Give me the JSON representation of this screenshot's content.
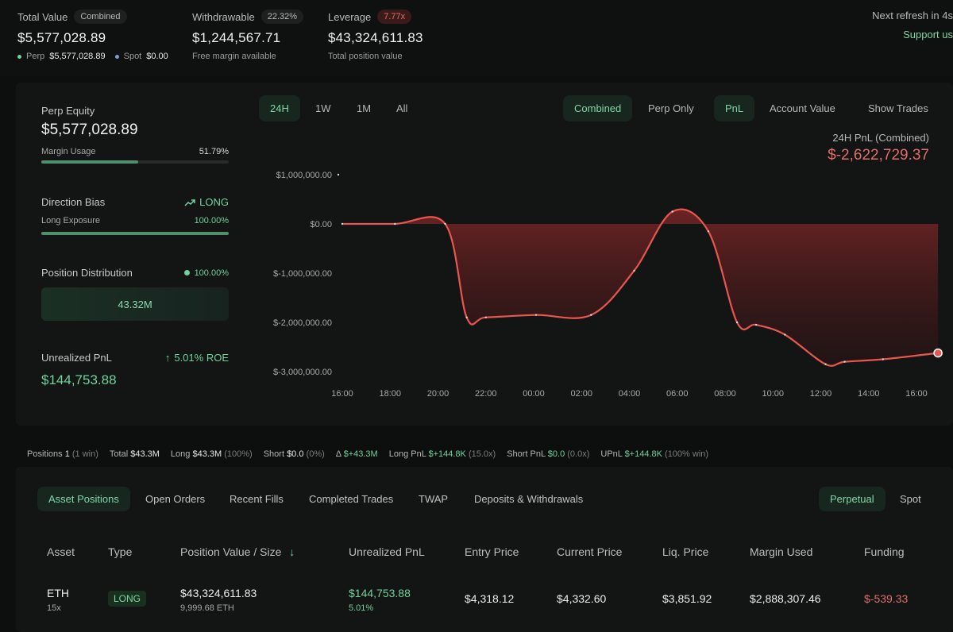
{
  "header": {
    "total_value": {
      "label": "Total Value",
      "pill": "Combined",
      "value": "$5,577,028.89",
      "perp_label": "Perp",
      "perp_value": "$5,577,028.89",
      "spot_label": "Spot",
      "spot_value": "$0.00"
    },
    "withdrawable": {
      "label": "Withdrawable",
      "pill": "22.32%",
      "value": "$1,244,567.71",
      "sub": "Free margin available"
    },
    "leverage": {
      "label": "Leverage",
      "pill": "7.77x",
      "value": "$43,324,611.83",
      "sub": "Total position value"
    },
    "refresh": "Next refresh in 4s",
    "support": "Support us"
  },
  "side": {
    "perp_equity_label": "Perp Equity",
    "perp_equity_value": "$5,577,028.89",
    "margin_usage_label": "Margin Usage",
    "margin_usage_value": "51.79%",
    "margin_usage_fraction": 0.5179,
    "direction_label": "Direction Bias",
    "direction_value": "LONG",
    "long_exposure_label": "Long Exposure",
    "long_exposure_value": "100.00%",
    "long_exposure_fraction": 1.0,
    "distribution_label": "Position Distribution",
    "distribution_value": "100.00%",
    "distribution_box": "43.32M",
    "upnl_label": "Unrealized PnL",
    "upnl_roe": "5.01% ROE",
    "upnl_value": "$144,753.88"
  },
  "chart_tabs": {
    "ranges": [
      "24H",
      "1W",
      "1M",
      "All"
    ],
    "modes": [
      "Combined",
      "Perp Only"
    ],
    "metrics": [
      "PnL",
      "Account Value"
    ],
    "show_trades": "Show Trades"
  },
  "chart_header": {
    "title": "24H PnL (Combined)",
    "total": "$-2,622,729.37"
  },
  "colors": {
    "accent_green": "#6fd39e",
    "loss_red": "#e06e68",
    "line_red": "#e8574f"
  },
  "chart_data": {
    "type": "area",
    "title": "24H PnL (Combined)",
    "xlabel": "",
    "ylabel": "",
    "x_ticks": [
      "16:00",
      "18:00",
      "20:00",
      "22:00",
      "00:00",
      "02:00",
      "04:00",
      "06:00",
      "08:00",
      "10:00",
      "12:00",
      "14:00",
      "16:00"
    ],
    "y_ticks": [
      "$1,000,000.00",
      "$0.00",
      "$-1,000,000.00",
      "$-2,000,000.00",
      "$-3,000,000.00"
    ],
    "ylim": [
      -3000000,
      1000000
    ],
    "grid": false,
    "series": [
      {
        "x_hours": [
          0,
          2.2,
          4.3,
          5.2,
          6.0,
          8.1,
          10.4,
          12.2,
          13.8,
          15.3,
          16.5,
          17.3,
          18.5,
          20.2,
          21.0,
          22.6,
          24.9
        ],
        "values": [
          0,
          0,
          0,
          -1900000,
          -1900000,
          -1850000,
          -1850000,
          -950000,
          250000,
          -150000,
          -2000000,
          -2050000,
          -2250000,
          -2850000,
          -2800000,
          -2750000,
          -2622729
        ]
      }
    ]
  },
  "summary": {
    "positions_label": "Positions",
    "positions": "1",
    "positions_note": "(1 win)",
    "total_label": "Total",
    "total": "$43.3M",
    "long_label": "Long",
    "long": "$43.3M",
    "long_note": "(100%)",
    "short_label": "Short",
    "short": "$0.0",
    "short_note": "(0%)",
    "delta_label": "Δ",
    "delta": "$+43.3M",
    "long_pnl_label": "Long PnL",
    "long_pnl": "$+144.8K",
    "long_pnl_note": "(15.0x)",
    "short_pnl_label": "Short PnL",
    "short_pnl": "$0.0",
    "short_pnl_note": "(0.0x)",
    "upnl_label": "UPnL",
    "upnl": "$+144.8K",
    "upnl_note": "(100% win)"
  },
  "bottom_tabs": [
    "Asset Positions",
    "Open Orders",
    "Recent Fills",
    "Completed Trades",
    "TWAP",
    "Deposits & Withdrawals"
  ],
  "market_tabs": [
    "Perpetual",
    "Spot"
  ],
  "table": {
    "headers": [
      "Asset",
      "Type",
      "Position Value / Size",
      "Unrealized PnL",
      "Entry Price",
      "Current Price",
      "Liq. Price",
      "Margin Used",
      "Funding"
    ],
    "sort_icon": "↓",
    "row": {
      "asset": "ETH",
      "leverage": "15x",
      "type": "LONG",
      "value": "$43,324,611.83",
      "size": "9,999.68 ETH",
      "upnl": "$144,753.88",
      "upnl_pct": "5.01%",
      "entry": "$4,318.12",
      "current": "$4,332.60",
      "liq": "$3,851.92",
      "margin": "$2,888,307.46",
      "funding": "$-539.33"
    }
  }
}
